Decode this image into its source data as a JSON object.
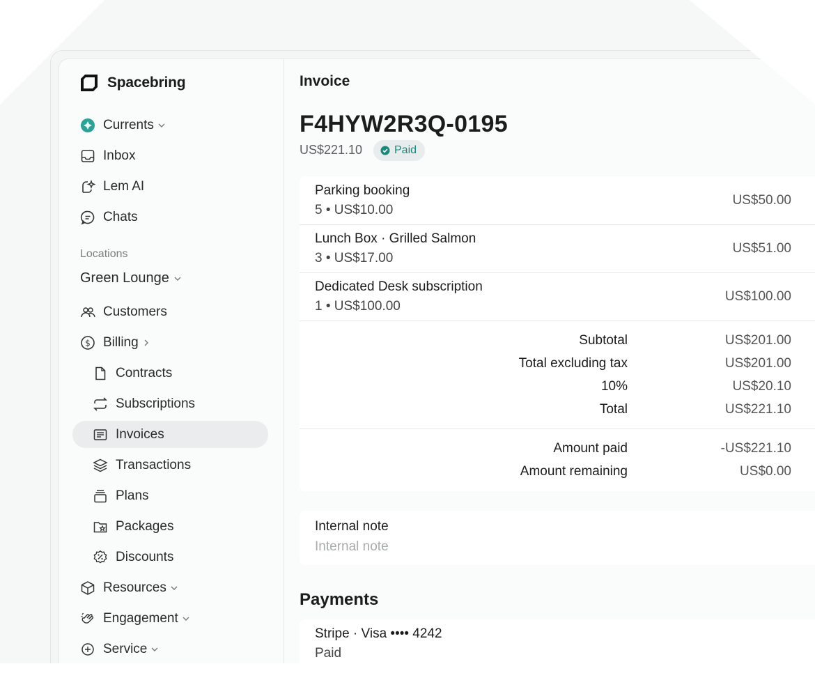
{
  "brand": {
    "name": "Spacebring"
  },
  "nav": {
    "top": [
      {
        "label": "Currents",
        "icon": "currents-icon"
      },
      {
        "label": "Inbox",
        "icon": "inbox-icon"
      },
      {
        "label": "Lem AI",
        "icon": "lem-ai-icon"
      },
      {
        "label": "Chats",
        "icon": "chat-icon"
      }
    ],
    "locations_label": "Locations",
    "location_name": "Green Lounge",
    "items": [
      {
        "label": "Customers",
        "icon": "customers-icon"
      },
      {
        "label": "Billing",
        "icon": "billing-icon"
      },
      {
        "label": "Contracts",
        "icon": "contract-icon"
      },
      {
        "label": "Subscriptions",
        "icon": "subscriptions-icon"
      },
      {
        "label": "Invoices",
        "icon": "invoices-icon",
        "active": true
      },
      {
        "label": "Transactions",
        "icon": "transactions-icon"
      },
      {
        "label": "Plans",
        "icon": "plans-icon"
      },
      {
        "label": "Packages",
        "icon": "packages-icon"
      },
      {
        "label": "Discounts",
        "icon": "discounts-icon"
      },
      {
        "label": "Resources",
        "icon": "resources-icon"
      },
      {
        "label": "Engagement",
        "icon": "engagement-icon"
      },
      {
        "label": "Service",
        "icon": "service-icon"
      }
    ]
  },
  "invoice": {
    "page_label": "Invoice",
    "number": "F4HYW2R3Q-0195",
    "amount": "US$221.10",
    "status": "Paid",
    "status_color": "#178a7c",
    "lines": [
      {
        "name": "Parking booking",
        "meta": "5 • US$10.00",
        "amount": "US$50.00"
      },
      {
        "name": "Lunch Box · Grilled Salmon",
        "meta": "3 • US$17.00",
        "amount": "US$51.00"
      },
      {
        "name": "Dedicated Desk subscription",
        "meta": "1 • US$100.00",
        "amount": "US$100.00"
      }
    ],
    "totals": [
      {
        "label": "Subtotal",
        "value": "US$201.00"
      },
      {
        "label": "Total excluding tax",
        "value": "US$201.00"
      },
      {
        "label": "10%",
        "value": "US$20.10"
      },
      {
        "label": "Total",
        "value": "US$221.10"
      }
    ],
    "amount_paid_label": "Amount paid",
    "amount_paid": "-US$221.10",
    "amount_remaining_label": "Amount remaining",
    "amount_remaining": "US$0.00"
  },
  "internal_note": {
    "title": "Internal note",
    "placeholder": "Internal note",
    "value": ""
  },
  "payments": {
    "title": "Payments",
    "items": [
      {
        "method": "Stripe · Visa •••• 4242",
        "status": "Paid"
      }
    ]
  }
}
